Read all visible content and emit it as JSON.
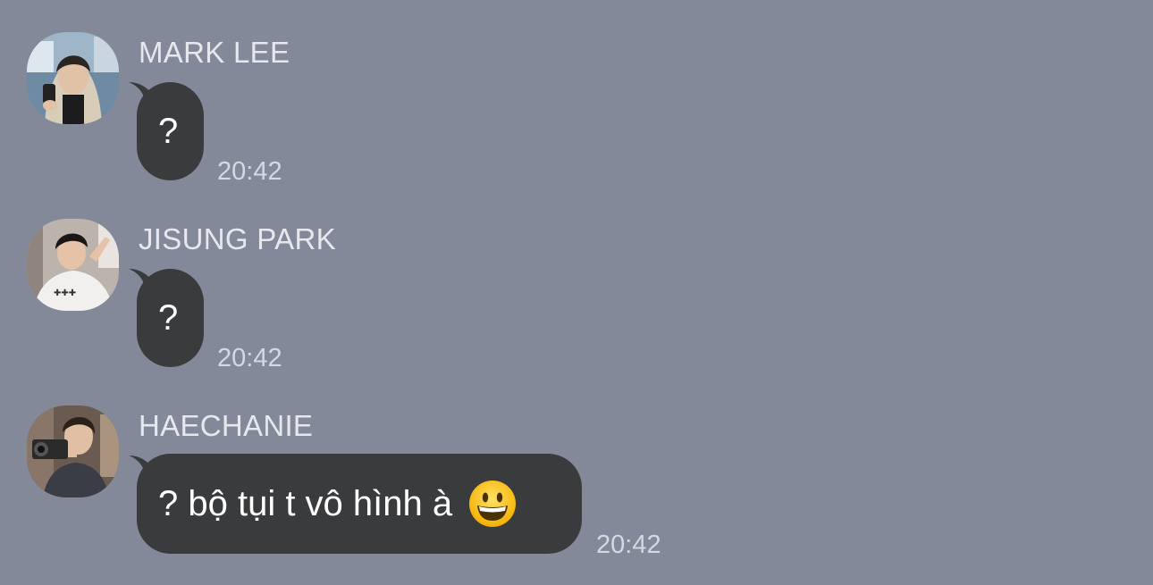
{
  "messages": [
    {
      "sender": "MARK LEE",
      "text": "?",
      "time": "20:42",
      "avatar_icon": "avatar-photo"
    },
    {
      "sender": "JISUNG PARK",
      "text": "?",
      "time": "20:42",
      "avatar_icon": "avatar-photo"
    },
    {
      "sender": "HAECHANIE",
      "text": "? bộ tụi t vô hình à",
      "emoji": "grinning-face-emoji",
      "time": "20:42",
      "avatar_icon": "avatar-photo"
    }
  ],
  "colors": {
    "background": "#838999",
    "bubble": "#3a3b3d",
    "sender_text": "#e6e8ee",
    "time_text": "#d5d8e0"
  }
}
